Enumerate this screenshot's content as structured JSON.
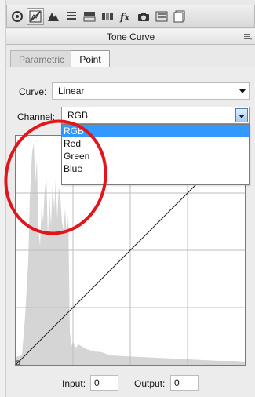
{
  "panel": {
    "title": "Tone Curve",
    "toolbar_icons": [
      "camera-shutter-icon",
      "histogram-icon",
      "mountains-icon",
      "list-lines-icon",
      "split-rect-icon",
      "bars-icon",
      "fx-icon",
      "camera-icon",
      "presets-icon",
      "snapshot-icon"
    ],
    "active_tool": "histogram-icon"
  },
  "tabs": [
    {
      "label": "Parametric",
      "active": false
    },
    {
      "label": "Point",
      "active": true
    }
  ],
  "curve": {
    "label": "Curve:",
    "value": "Linear"
  },
  "channel": {
    "label": "Channel:",
    "value": "RGB",
    "options": [
      "RGB",
      "Red",
      "Green",
      "Blue"
    ],
    "selected": "RGB"
  },
  "io": {
    "input_label": "Input:",
    "input_value": "0",
    "output_label": "Output:",
    "output_value": "0"
  },
  "colors": {
    "annotation": "#e3151a",
    "selection": "#3399ff",
    "histogram": "#d5d5d5"
  }
}
